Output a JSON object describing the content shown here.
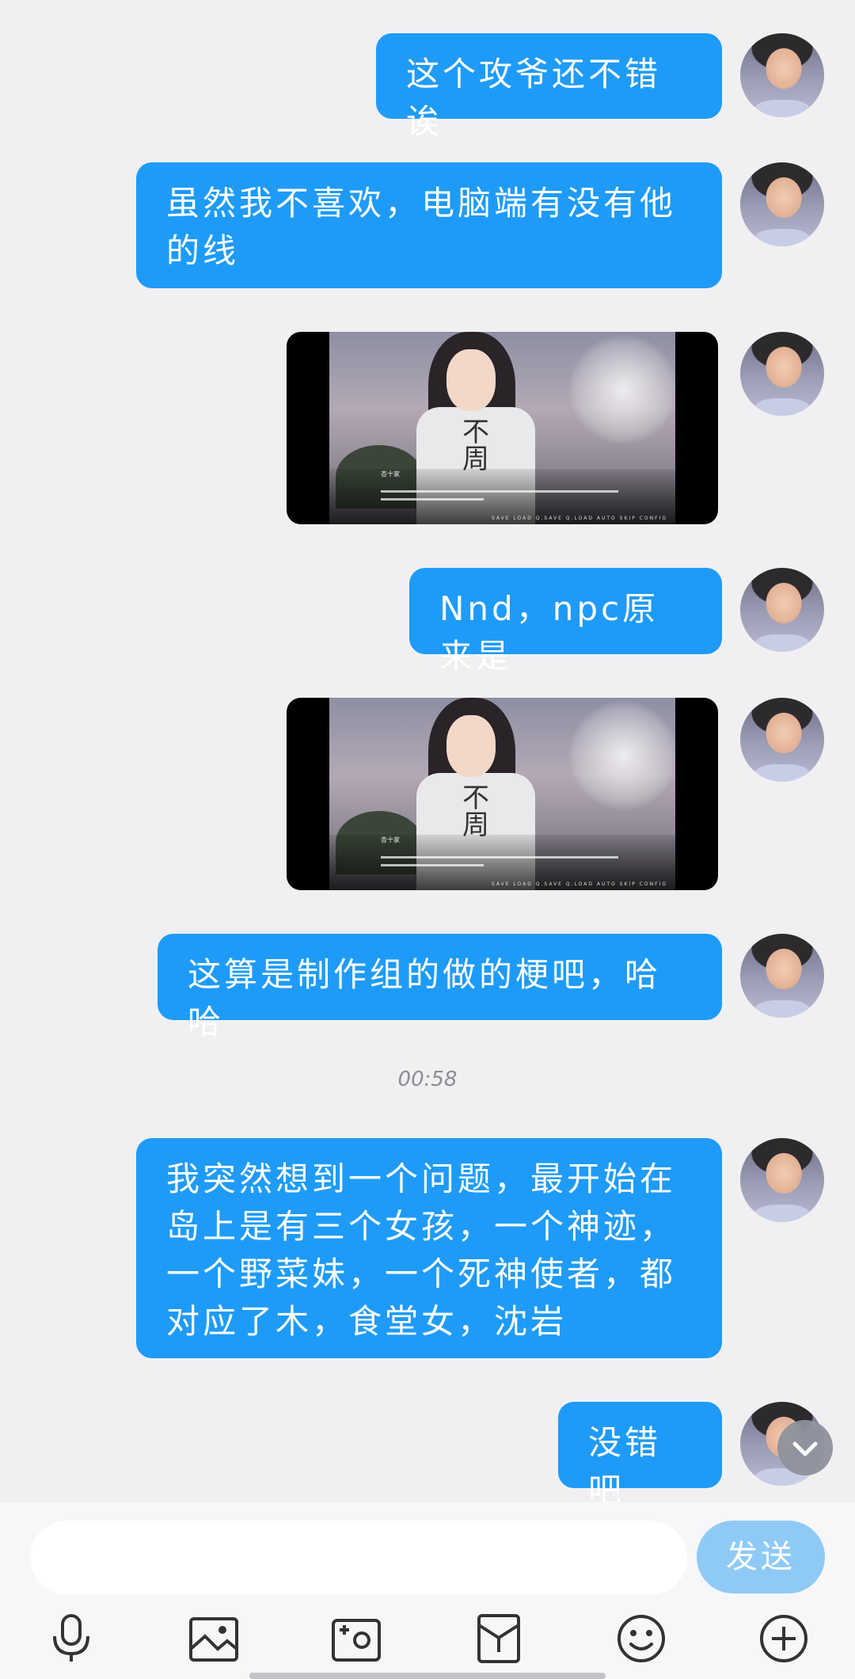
{
  "messages": [
    {
      "type": "text",
      "text": "这个攻爷还不错诶"
    },
    {
      "type": "text",
      "text": "虽然我不喜欢，电脑端有没有他的线"
    },
    {
      "type": "image",
      "caption_name": "杏十家",
      "shirt_text": "不周",
      "menu": "SAVE  LOAD  Q.SAVE  Q.LOAD  AUTO  SKIP  CONFIG"
    },
    {
      "type": "text",
      "text": "Nnd，npc原来是"
    },
    {
      "type": "image",
      "caption_name": "杏十家",
      "shirt_text": "不周",
      "menu": "SAVE  LOAD  Q.SAVE  Q.LOAD  AUTO  SKIP  CONFIG"
    },
    {
      "type": "text",
      "text": "这算是制作组的做的梗吧，哈哈"
    },
    {
      "type": "text",
      "text": "我突然想到一个问题，最开始在岛上是有三个女孩，一个神迹，一个野菜妹，一个死神使者，都对应了木，食堂女，沈岩"
    },
    {
      "type": "text",
      "text": "没错吧"
    }
  ],
  "timestamp": "00:58",
  "composer": {
    "placeholder": "",
    "send_label": "发送"
  },
  "toolbar": [
    "microphone-icon",
    "image-icon",
    "camera-icon",
    "red-packet-icon",
    "emoji-icon",
    "plus-icon"
  ],
  "colors": {
    "bubble": "#1e9bf8",
    "send_button": "#8fcaf6",
    "background": "#f0f0f2"
  }
}
